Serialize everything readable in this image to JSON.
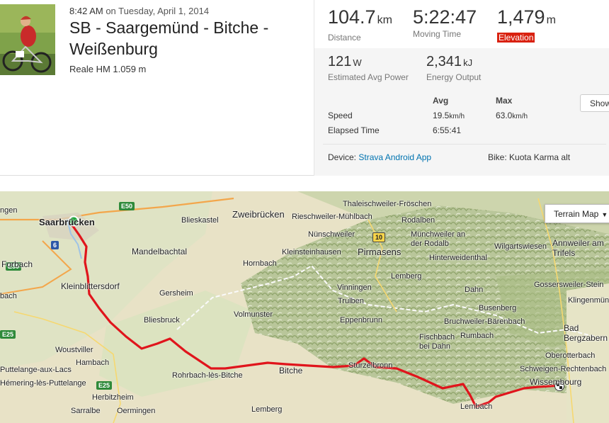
{
  "activity": {
    "time_prefix": "8:42 AM",
    "time_suffix": "on Tuesday, April 1, 2014",
    "title": "SB - Saargemünd - Bitche - Weißenburg",
    "description": "Reale HM 1.059 m"
  },
  "stats": {
    "distance": {
      "value": "104.7",
      "unit": "km",
      "label": "Distance"
    },
    "moving_time": {
      "value": "5:22:47",
      "label": "Moving Time"
    },
    "elevation": {
      "value": "1,479",
      "unit": "m",
      "label": "Elevation"
    },
    "power": {
      "value": "121",
      "unit": "W",
      "label": "Estimated Avg Power"
    },
    "energy": {
      "value": "2,341",
      "unit": "kJ",
      "label": "Energy Output"
    }
  },
  "table": {
    "headers": {
      "avg": "Avg",
      "max": "Max"
    },
    "speed": {
      "label": "Speed",
      "avg": "19.5",
      "avg_unit": "km/h",
      "max": "63.0",
      "max_unit": "km/h"
    },
    "elapsed": {
      "label": "Elapsed Time",
      "avg": "6:55:41"
    },
    "show_label": "Show"
  },
  "gear": {
    "device_label": "Device:",
    "device_value": "Strava Android App",
    "bike_label": "Bike:",
    "bike_value": "Kuota Karma alt"
  },
  "map": {
    "type_control": "Terrain Map",
    "route_color": "#e0151c",
    "places": {
      "saarbruecken": "Saarbrücken",
      "forbach": "Forbach",
      "kleinblittersdorf": "Kleinblittersdorf",
      "mandelbachtal": "Mandelbachtal",
      "blieskastel": "Blieskastel",
      "zweibruecken": "Zweibrücken",
      "gersheim": "Gersheim",
      "hornbach": "Hornbach",
      "volmunster": "Volmunster",
      "bliesbruck": "Bliesbruck",
      "woustviller": "Woustviller",
      "hambach": "Hambach",
      "puttelange": "Puttelange-aux-Lacs",
      "hemering": "Hémering-lès-Puttelange",
      "herbitzheim": "Herbitzheim",
      "sarralbe": "Sarralbe",
      "oermingen": "Oermingen",
      "rohrbach": "Rohrbach-lès-Bitche",
      "lemberg_s": "Lemberg",
      "bitche": "Bitche",
      "sturzelbronn": "Sturzelbronn",
      "lembach": "Lembach",
      "wissembourg": "Wissembourg",
      "schweigen": "Schweigen-Rechtenbach",
      "oberotterbach": "Oberotterbach",
      "bad_bergzabern": "Bad Bergzabern",
      "thaleischweiler": "Thaleischweiler-Fröschen",
      "rieschweiler": "Rieschweiler-Mühlbach",
      "rodalben": "Rodalben",
      "nuenschweiler": "Nünschweiler",
      "kleinsteinhausen": "Kleinsteinhausen",
      "pirmasens": "Pirmasens",
      "muenchweiler": "Münchweiler an der Rodalb",
      "wilgartswiesen": "Wilgartswiesen",
      "annweiler": "Annweiler am Trifels",
      "hinterweidenthal": "Hinterweidenthal",
      "lemberg_n": "Lemberg",
      "vinningen": "Vinningen",
      "trulben": "Trulben",
      "dahn": "Dahn",
      "gossersweiler": "Gossersweiler-Stein",
      "klingenmuenster": "Klingenmünster",
      "busenberg": "Busenberg",
      "eppenbrunn": "Eppenbrunn",
      "bruchweiler": "Bruchweiler-Bärenbach",
      "fischbach": "Fischbach bei Dahn",
      "rumbach": "Rumbach",
      "gen_l": "ngen",
      "bach": "bach"
    },
    "roads": {
      "e50": "E50",
      "r6": "6",
      "e50b": "E50",
      "e25": "E25",
      "r10": "10",
      "e25b": "E25"
    }
  }
}
